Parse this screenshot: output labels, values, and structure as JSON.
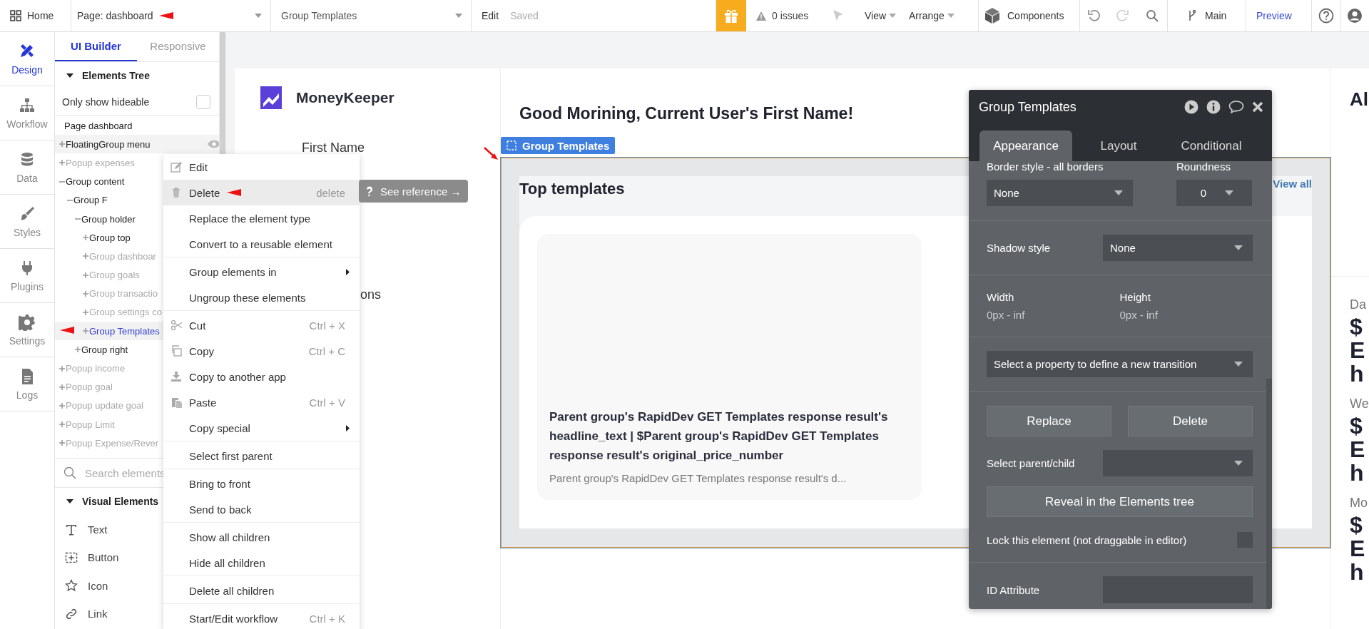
{
  "annotations": [
    {
      "kind": "page_selector"
    },
    {
      "kind": "menu_item"
    },
    {
      "kind": "tree_item"
    },
    {
      "kind": "canvas"
    }
  ],
  "topbar": {
    "home": "Home",
    "page_selector": {
      "value": "Page: dashboard"
    },
    "element_selector": "Group Templates",
    "edit": "Edit",
    "save_status": "Saved",
    "issues": "0 issues",
    "view": "View",
    "arrange": "Arrange",
    "components": "Components",
    "branch": "Main",
    "preview": "Preview"
  },
  "rail": [
    {
      "label": "Design",
      "kind": "design",
      "selected": true
    },
    {
      "label": "Workflow",
      "kind": "workflow",
      "selected": false
    },
    {
      "label": "Data",
      "kind": "data",
      "selected": false
    },
    {
      "label": "Styles",
      "kind": "styles",
      "selected": false
    },
    {
      "label": "Plugins",
      "kind": "plugins",
      "selected": false
    },
    {
      "label": "Settings",
      "kind": "settings",
      "selected": false
    },
    {
      "label": "Logs",
      "kind": "logs",
      "selected": false
    }
  ],
  "panel": {
    "tabs": [
      {
        "label": "UI Builder",
        "selected": true
      },
      {
        "label": "Responsive",
        "selected": false
      }
    ],
    "tree_title": "Elements Tree",
    "hideable": {
      "label": "Only show hideable",
      "checked": false
    },
    "tree": {
      "label": "Page dashboard",
      "children": [
        {
          "label": "FloatingGroup menu",
          "expanded": false,
          "hidden": false,
          "hovered": true,
          "selected": false
        },
        {
          "label": "Popup expenses",
          "expanded": false,
          "hidden": true,
          "hovered": false,
          "selected": false
        },
        {
          "label": "Group content",
          "expanded": true,
          "hidden": false,
          "hovered": false,
          "selected": false,
          "children": [
            {
              "label": "Group F",
              "expanded": true,
              "hidden": false,
              "hovered": false,
              "selected": false,
              "children": [
                {
                  "label": "Group holder",
                  "expanded": true,
                  "hidden": false,
                  "hovered": false,
                  "selected": false,
                  "children": [
                    {
                      "label": "Group top",
                      "expanded": false,
                      "hidden": false,
                      "hovered": false,
                      "selected": false
                    },
                    {
                      "label": "Group dashboar",
                      "expanded": false,
                      "hidden": true,
                      "hovered": false,
                      "selected": false
                    },
                    {
                      "label": "Group goals",
                      "expanded": false,
                      "hidden": true,
                      "hovered": false,
                      "selected": false
                    },
                    {
                      "label": "Group transactio",
                      "expanded": false,
                      "hidden": true,
                      "hovered": false,
                      "selected": false
                    },
                    {
                      "label": "Group settings co",
                      "expanded": false,
                      "hidden": true,
                      "hovered": false,
                      "selected": false
                    },
                    {
                      "label": "Group Templates",
                      "expanded": false,
                      "hidden": false,
                      "hovered": false,
                      "selected": true
                    }
                  ]
                },
                {
                  "label": "Group right",
                  "expanded": false,
                  "hidden": false,
                  "hovered": false,
                  "selected": false
                }
              ]
            }
          ]
        },
        {
          "label": "Popup income",
          "expanded": false,
          "hidden": true,
          "hovered": false,
          "selected": false
        },
        {
          "label": "Popup goal",
          "expanded": false,
          "hidden": true,
          "hovered": false,
          "selected": false
        },
        {
          "label": "Popup update goal",
          "expanded": false,
          "hidden": true,
          "hovered": false,
          "selected": false
        },
        {
          "label": "Popup Limit",
          "expanded": false,
          "hidden": true,
          "hovered": false,
          "selected": false
        },
        {
          "label": "Popup Expense/Rever",
          "expanded": false,
          "hidden": true,
          "hovered": false,
          "selected": false
        }
      ]
    },
    "search": {
      "placeholder": "Search elements"
    },
    "visual_title": "Visual Elements",
    "visual_elements": [
      {
        "label": "Text",
        "kind": "text"
      },
      {
        "label": "Button",
        "kind": "button"
      },
      {
        "label": "Icon",
        "kind": "icon"
      },
      {
        "label": "Link",
        "kind": "link"
      }
    ]
  },
  "context_menu": {
    "sections": [
      [
        {
          "label": "Edit",
          "kind": "edit",
          "selected": false
        },
        {
          "label": "Delete",
          "kind": "delete",
          "shortcut": "delete",
          "selected": true
        },
        {
          "label": "Replace the element type",
          "kind": "plain",
          "selected": false
        },
        {
          "label": "Convert to a reusable element",
          "kind": "plain",
          "selected": false
        }
      ],
      [
        {
          "label": "Group elements in",
          "kind": "submenu",
          "selected": false
        },
        {
          "label": "Ungroup these elements",
          "kind": "plain",
          "selected": false
        }
      ],
      [
        {
          "label": "Cut",
          "kind": "cut",
          "shortcut": "Ctrl + X",
          "selected": false
        },
        {
          "label": "Copy",
          "kind": "copy",
          "shortcut": "Ctrl + C",
          "selected": false
        },
        {
          "label": "Copy to another app",
          "kind": "export",
          "selected": false
        },
        {
          "label": "Paste",
          "kind": "paste",
          "shortcut": "Ctrl + V",
          "selected": false
        },
        {
          "label": "Copy special",
          "kind": "submenu",
          "selected": false
        }
      ],
      [
        {
          "label": "Select first parent",
          "kind": "plain",
          "selected": false
        }
      ],
      [
        {
          "label": "Bring to front",
          "kind": "plain",
          "selected": false
        },
        {
          "label": "Send to back",
          "kind": "plain",
          "selected": false
        }
      ],
      [
        {
          "label": "Show all children",
          "kind": "plain",
          "selected": false
        },
        {
          "label": "Hide all children",
          "kind": "plain",
          "selected": false
        }
      ],
      [
        {
          "label": "Delete all children",
          "kind": "plain",
          "selected": false
        }
      ],
      [
        {
          "label": "Start/Edit workflow",
          "kind": "plain",
          "shortcut": "Ctrl + K",
          "selected": false
        }
      ]
    ]
  },
  "reference_tip": {
    "label": "See reference →"
  },
  "page": {
    "app_name": "MoneyKeeper",
    "nav": [
      {
        "label": "First Name"
      },
      {
        "label": "ons"
      }
    ],
    "greeting": "Good Morining, Current User's First Name!",
    "selection": {
      "label": "Group Templates"
    },
    "section_title": "Top templates",
    "view_all": "View all",
    "card": {
      "title": "Parent group's RapidDev GET Templates response result's headline_text | $Parent group's RapidDev GET Templates response result's original_price_number",
      "description": "Parent group's RapidDev GET Templates response result's d..."
    },
    "right_column": {
      "title": "Al",
      "stats": [
        {
          "label": "Da",
          "lines": [
            "$",
            "E",
            "h"
          ]
        },
        {
          "label": "We",
          "lines": [
            "$",
            "E",
            "h"
          ]
        },
        {
          "label": "Mo",
          "lines": [
            "$",
            "E",
            "h"
          ]
        }
      ]
    }
  },
  "property_editor": {
    "title": "Group Templates",
    "tabs": [
      {
        "label": "Appearance",
        "selected": true
      },
      {
        "label": "Layout",
        "selected": false
      },
      {
        "label": "Conditional",
        "selected": false
      }
    ],
    "border_style": {
      "label": "Border style - all borders",
      "value": "None"
    },
    "roundness": {
      "label": "Roundness",
      "value": "0"
    },
    "shadow": {
      "label": "Shadow style",
      "value": "None"
    },
    "width": {
      "label": "Width",
      "value": "0px - inf"
    },
    "height": {
      "label": "Height",
      "value": "0px - inf"
    },
    "transition": {
      "value": "Select a property to define a new transition"
    },
    "actions": [
      "Replace",
      "Delete"
    ],
    "parent_child": {
      "label": "Select parent/child"
    },
    "reveal": "Reveal in the Elements tree",
    "lock": {
      "label": "Lock this element (not draggable in editor)",
      "checked": false
    },
    "id_attribute": {
      "label": "ID Attribute"
    }
  }
}
